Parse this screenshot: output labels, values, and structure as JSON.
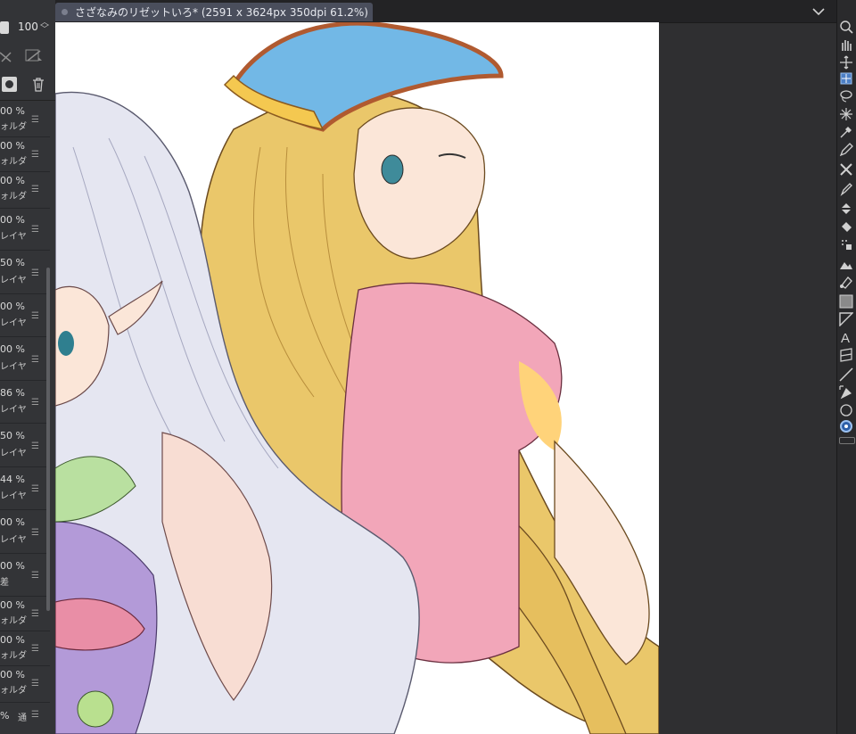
{
  "window": {
    "tab_title": "さざなみのリゼットいろ* (2591 x 3624px 350dpi 61.2%)"
  },
  "layer_panel": {
    "opacity_value": "100",
    "layers": [
      {
        "opacity": "00 %",
        "kind": "ォルダ"
      },
      {
        "opacity": "00 %",
        "kind": "ォルダ"
      },
      {
        "opacity": "00 %",
        "kind": "ォルダ"
      },
      {
        "opacity": "00 %",
        "kind": "レイヤ"
      },
      {
        "opacity": "50 %",
        "kind": "レイヤ"
      },
      {
        "opacity": "00 %",
        "kind": "レイヤ"
      },
      {
        "opacity": "00 %",
        "kind": "レイヤ"
      },
      {
        "opacity": "86 %",
        "kind": "レイヤ"
      },
      {
        "opacity": "50 %",
        "kind": "レイヤ"
      },
      {
        "opacity": "44 %",
        "kind": "レイヤ"
      },
      {
        "opacity": "00 %",
        "kind": "レイヤ"
      },
      {
        "opacity": "00 %",
        "kind": "差"
      },
      {
        "opacity": "00 %",
        "kind": "ォルダ"
      },
      {
        "opacity": "00 %",
        "kind": "ォルダ"
      },
      {
        "opacity": "00 %",
        "kind": "ォルダ"
      },
      {
        "opacity": "%",
        "kind": "通"
      }
    ]
  },
  "toolbar": {
    "tools": [
      "zoom-icon",
      "hand-icon",
      "move-icon",
      "move-layer-icon",
      "lasso-icon",
      "magic-wand-icon",
      "eyedropper-icon",
      "pen-icon",
      "pencil-icon",
      "brush-icon",
      "airbrush-icon",
      "eraser-icon",
      "fill-icon",
      "gradient-icon",
      "text-icon",
      "frame-icon",
      "ruler-icon",
      "operation-icon",
      "shape-icon",
      "color-wheel-icon"
    ]
  },
  "colors": {
    "panel_bg": "#333437",
    "tab_bg": "#4a4e5c",
    "canvas_bg": "#ffffff",
    "accent": "#5b8fd8"
  }
}
